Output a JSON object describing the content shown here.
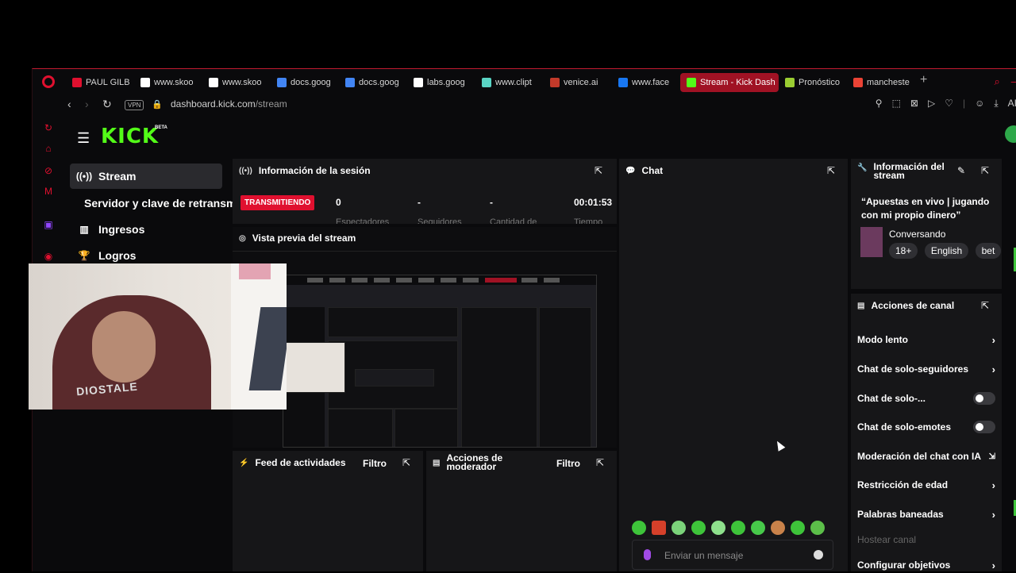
{
  "browser": {
    "tabs": [
      {
        "label": "PAUL GILB",
        "color": "#e0102f",
        "active": false
      },
      {
        "label": "www.skoo",
        "color": "#ffffff",
        "active": false
      },
      {
        "label": "www.skoo",
        "color": "#ffffff",
        "active": false
      },
      {
        "label": "docs.goog",
        "color": "#4285f4",
        "active": false
      },
      {
        "label": "docs.goog",
        "color": "#4285f4",
        "active": false
      },
      {
        "label": "labs.goog",
        "color": "#ffffff",
        "active": false
      },
      {
        "label": "www.clipt",
        "color": "#5ad4c4",
        "active": false
      },
      {
        "label": "venice.ai",
        "color": "#c23a2a",
        "active": false
      },
      {
        "label": "www.face",
        "color": "#1877f2",
        "active": false
      },
      {
        "label": "Stream - Kick Dash",
        "color": "#53fc18",
        "active": true
      },
      {
        "label": "Pronóstico",
        "color": "#9acd32",
        "active": false
      },
      {
        "label": "mancheste",
        "color": "#ea4335",
        "active": false
      }
    ],
    "vpn": "VPN",
    "url_host": "dashboard.kick.com",
    "url_path": "/stream",
    "right_label": "AI"
  },
  "kick": {
    "logo": "KICK",
    "beta": "BETA",
    "nav": [
      {
        "label": "Stream",
        "icon": "broadcast-icon"
      },
      {
        "label": "Servidor y clave de retransm",
        "icon": ""
      },
      {
        "label": "Ingresos",
        "icon": "chart-icon"
      },
      {
        "label": "Logros",
        "icon": "trophy-icon"
      }
    ]
  },
  "session": {
    "title": "Información de la sesión",
    "status": "TRANSMITIENDO",
    "viewers": "0",
    "followers": "-",
    "amount": "-",
    "time": "00:01:53",
    "viewers_label": "Espectadores",
    "followers_label": "Seguidores",
    "amount_label": "Cantidad de",
    "time_label": "Tiempo"
  },
  "preview": {
    "title": "Vista previa del stream"
  },
  "feed": {
    "title": "Feed de actividades",
    "filter": "Filtro"
  },
  "modactions": {
    "title_line1": "Acciones de",
    "title_line2": "moderador",
    "filter": "Filtro"
  },
  "chat": {
    "title": "Chat",
    "placeholder": "Enviar un mensaje"
  },
  "stream_info": {
    "title_line1": "Información del",
    "title_line2": "stream",
    "stream_title": "“Apuestas en vivo | jugando con mi propio dinero”",
    "category": "Conversando",
    "tags": [
      "18+",
      "English",
      "bet"
    ]
  },
  "channel_actions": {
    "title": "Acciones de canal",
    "slow_mode": "Modo lento",
    "followers_only": "Chat de solo-seguidores",
    "subs_only": "Chat de solo-...",
    "emotes_only": "Chat de solo-emotes",
    "ai_mod": "Moderación del chat con IA",
    "age_restriction": "Restricción de edad",
    "banned_words": "Palabras baneadas",
    "host": "Hostear canal",
    "goals": "Configurar objetivos"
  },
  "webcam": {
    "shirt_text": "DIOSTALE"
  }
}
